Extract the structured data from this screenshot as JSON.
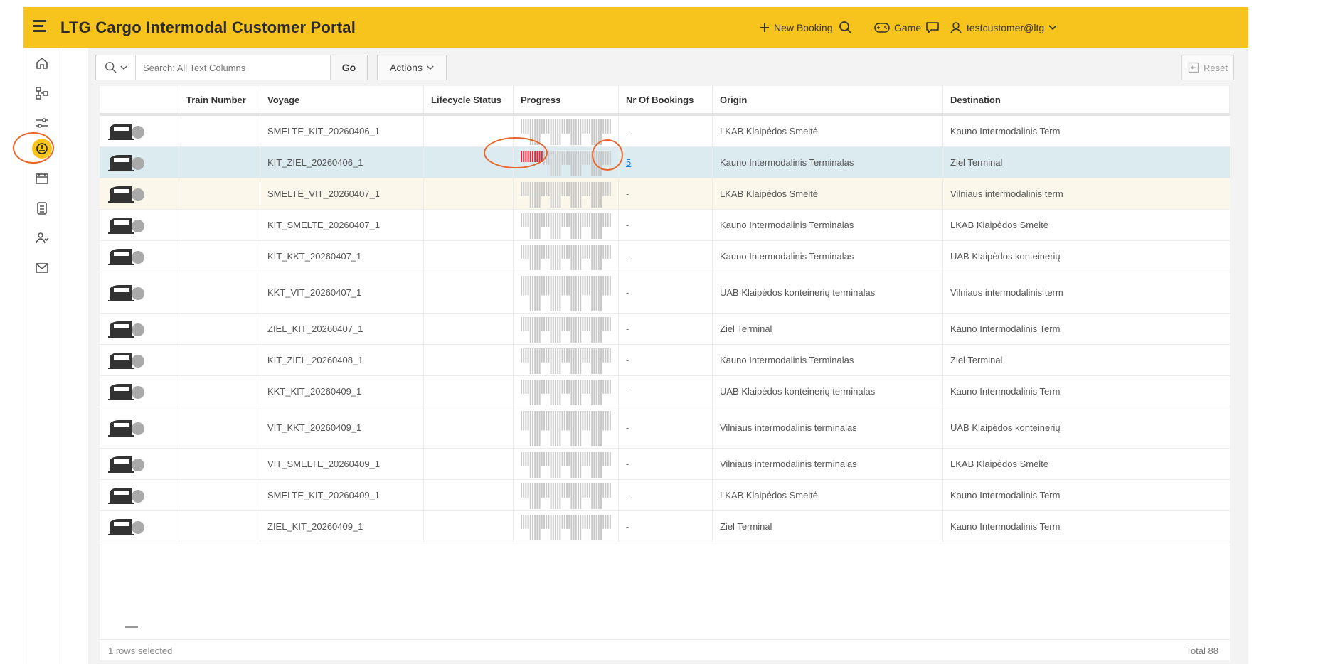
{
  "header": {
    "title": "LTG Cargo Intermodal Customer Portal",
    "new_booking": "New Booking",
    "game": "Game",
    "user": "testcustomer@ltg",
    "accent": "#f7c31d"
  },
  "sidebar": {
    "items": [
      {
        "icon": "home-icon"
      },
      {
        "icon": "network-icon"
      },
      {
        "icon": "sliders-icon"
      },
      {
        "icon": "dashboard-icon",
        "active": true
      },
      {
        "icon": "calendar-icon"
      },
      {
        "icon": "document-icon"
      },
      {
        "icon": "users-icon"
      },
      {
        "icon": "mail-icon"
      }
    ]
  },
  "toolbar": {
    "search_placeholder": "Search: All Text Columns",
    "go_label": "Go",
    "actions_label": "Actions",
    "reset_label": "Reset"
  },
  "table": {
    "columns": [
      "Train Number",
      "Voyage",
      "Lifecycle Status",
      "Progress",
      "Nr Of Bookings",
      "Origin",
      "Destination"
    ],
    "rows": [
      {
        "voyage": "SMELTE_KIT_20260406_1",
        "bookings": "-",
        "origin": "LKAB Klaipėdos Smeltė",
        "destination": "Kauno Intermodalinis Term",
        "progress": 0
      },
      {
        "voyage": "KIT_ZIEL_20260406_1",
        "bookings": "5",
        "origin": "Kauno Intermodalinis Terminalas",
        "destination": "Ziel Terminal",
        "progress": 0.25,
        "selected": true
      },
      {
        "voyage": "SMELTE_VIT_20260407_1",
        "bookings": "-",
        "origin": "LKAB Klaipėdos Smeltė",
        "destination": "Vilniaus intermodalinis term",
        "progress": 0,
        "hovered": true
      },
      {
        "voyage": "KIT_SMELTE_20260407_1",
        "bookings": "-",
        "origin": "Kauno Intermodalinis Terminalas",
        "destination": "LKAB Klaipėdos Smeltė",
        "progress": 0
      },
      {
        "voyage": "KIT_KKT_20260407_1",
        "bookings": "-",
        "origin": "Kauno Intermodalinis Terminalas",
        "destination": "UAB Klaipėdos konteinerių",
        "progress": 0
      },
      {
        "voyage": "KKT_VIT_20260407_1",
        "bookings": "-",
        "origin": "UAB Klaipėdos konteinerių terminalas",
        "destination": "Vilniaus intermodalinis term",
        "progress": 0
      },
      {
        "voyage": "ZIEL_KIT_20260407_1",
        "bookings": "-",
        "origin": "Ziel Terminal",
        "destination": "Kauno Intermodalinis Term",
        "progress": 0
      },
      {
        "voyage": "KIT_ZIEL_20260408_1",
        "bookings": "-",
        "origin": "Kauno Intermodalinis Terminalas",
        "destination": "Ziel Terminal",
        "progress": 0
      },
      {
        "voyage": "KKT_KIT_20260409_1",
        "bookings": "-",
        "origin": "UAB Klaipėdos konteinerių terminalas",
        "destination": "Kauno Intermodalinis Term",
        "progress": 0
      },
      {
        "voyage": "VIT_KKT_20260409_1",
        "bookings": "-",
        "origin": "Vilniaus intermodalinis terminalas",
        "destination": "UAB Klaipėdos konteinerių",
        "progress": 0
      },
      {
        "voyage": "VIT_SMELTE_20260409_1",
        "bookings": "-",
        "origin": "Vilniaus intermodalinis terminalas",
        "destination": "LKAB Klaipėdos Smeltė",
        "progress": 0
      },
      {
        "voyage": "SMELTE_KIT_20260409_1",
        "bookings": "-",
        "origin": "LKAB Klaipėdos Smeltė",
        "destination": "Kauno Intermodalinis Term",
        "progress": 0
      },
      {
        "voyage": "ZIEL_KIT_20260409_1",
        "bookings": "-",
        "origin": "Ziel Terminal",
        "destination": "Kauno Intermodalinis Term",
        "progress": 0
      }
    ]
  },
  "footer": {
    "selected": "1 rows selected",
    "total": "Total 88"
  },
  "colors": {
    "progress_filled": "#e8283a",
    "progress_empty": "#c9c9c9",
    "highlight_ring": "#e8662a",
    "link": "#2a7ad1"
  }
}
